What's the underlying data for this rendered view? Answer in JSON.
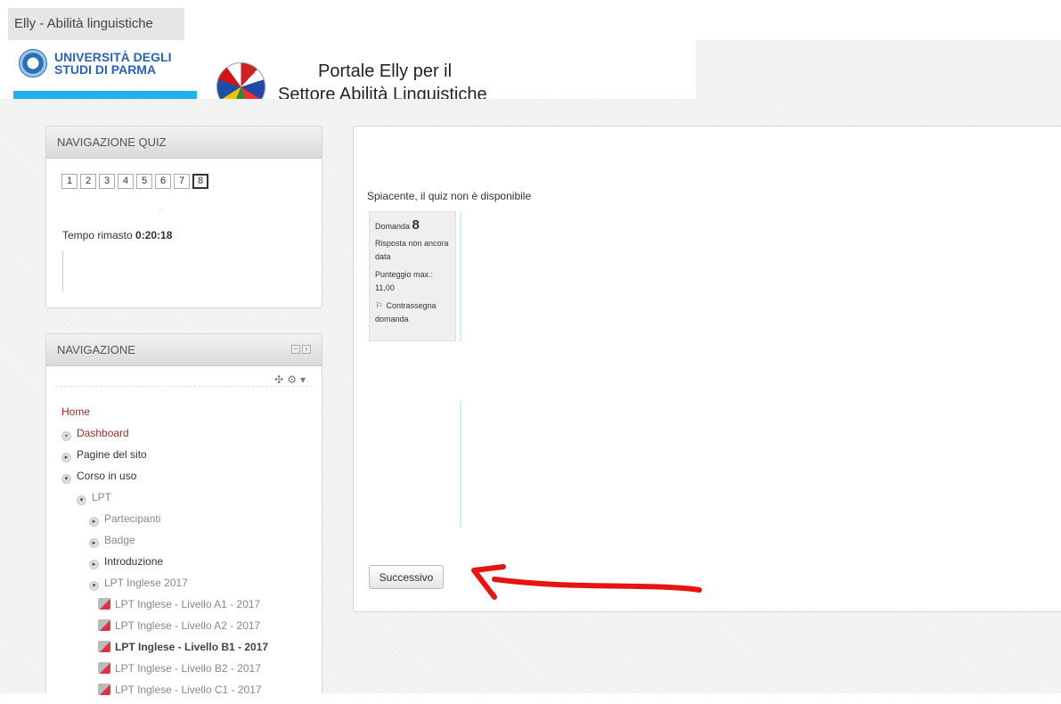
{
  "window": {
    "title": "Elly - Abilità linguistiche"
  },
  "header": {
    "university_line1": "UNIVERSITÀ DEGLI",
    "university_line2": "STUDI DI PARMA",
    "portal_title_line1": "Portale Elly per il",
    "portal_title_line2": "Settore Abilità Linguistiche"
  },
  "quiz_navigation": {
    "title": "NAVIGAZIONE QUIZ",
    "questions": [
      "1",
      "2",
      "3",
      "4",
      "5",
      "6",
      "7",
      "8"
    ],
    "current": "8",
    "time_label": "Tempo rimasto",
    "time_value": "0:20:18"
  },
  "navigation": {
    "title": "NAVIGAZIONE",
    "items": [
      {
        "label": "Home"
      },
      {
        "label": "Dashboard"
      },
      {
        "label": "Pagine del sito"
      },
      {
        "label": "Corso in uso"
      },
      {
        "label": "LPT"
      },
      {
        "label": "Partecipanti"
      },
      {
        "label": "Badge"
      },
      {
        "label": "Introduzione"
      },
      {
        "label": "LPT Inglese 2017"
      },
      {
        "label": "LPT Inglese - Livello A1 - 2017"
      },
      {
        "label": "LPT Inglese - Livello A2 - 2017"
      },
      {
        "label": "LPT Inglese - Livello B1 - 2017"
      },
      {
        "label": "LPT Inglese - Livello B2 - 2017"
      },
      {
        "label": "LPT Inglese - Livello C1 - 2017"
      }
    ]
  },
  "main": {
    "message": "Spiacente, il quiz non è disponibile",
    "question": {
      "label": "Domanda",
      "number": "8",
      "status": "Risposta non ancora data",
      "max_score_label": "Punteggio max.:",
      "max_score_value": "11,00",
      "flag_label": "Contrassegna domanda"
    },
    "next_button": "Successivo"
  },
  "colors": {
    "link_red": "#9b2a2a",
    "annotation_arrow": "#e8140f",
    "accent_cyan": "#1cb3ea"
  }
}
